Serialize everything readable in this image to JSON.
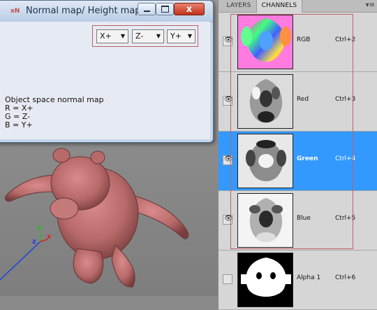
{
  "dialog": {
    "app_icon": "xN",
    "title": "Normal map/ Height map",
    "window_buttons": {
      "minimize": "minimize-icon",
      "maximize": "maximize-icon",
      "close_label": "x"
    },
    "axis_selects": {
      "x": "X+",
      "z": "Z-",
      "y": "Y+"
    },
    "description": [
      "Object space normal map",
      "R = X+",
      "G = Z-",
      "B = Y+"
    ]
  },
  "viewport": {
    "axes": {
      "x": "x",
      "y": "y",
      "z": "z"
    },
    "colors": {
      "model": "#c07474",
      "x_axis": "#e02020",
      "y_axis": "#20c020",
      "z_axis": "#2040e0"
    }
  },
  "channels_panel": {
    "tabs": [
      "LAYERS",
      "CHANNELS"
    ],
    "active_tab": "CHANNELS",
    "menu_icon": "panel-menu-icon",
    "selection_color": "#3399ff",
    "channels": [
      {
        "name": "RGB",
        "shortcut": "Ctrl+2",
        "visible": true,
        "selected": false
      },
      {
        "name": "Red",
        "shortcut": "Ctrl+3",
        "visible": true,
        "selected": false
      },
      {
        "name": "Green",
        "shortcut": "Ctrl+4",
        "visible": true,
        "selected": true
      },
      {
        "name": "Blue",
        "shortcut": "Ctrl+5",
        "visible": true,
        "selected": false
      },
      {
        "name": "Alpha 1",
        "shortcut": "Ctrl+6",
        "visible": false,
        "selected": false
      }
    ]
  }
}
